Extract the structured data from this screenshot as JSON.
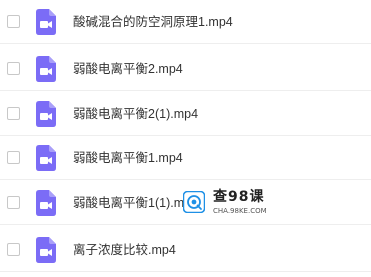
{
  "files": [
    {
      "name": "酸碱混合的防空洞原理1.mp4",
      "icon": "video-file-icon"
    },
    {
      "name": "弱酸电离平衡2.mp4",
      "icon": "video-file-icon"
    },
    {
      "name": "弱酸电离平衡2(1).mp4",
      "icon": "video-file-icon"
    },
    {
      "name": "弱酸电离平衡1.mp4",
      "icon": "video-file-icon"
    },
    {
      "name": "弱酸电离平衡1(1).mp4",
      "icon": "video-file-icon"
    },
    {
      "name": "离子浓度比较.mp4",
      "icon": "video-file-icon"
    }
  ],
  "watermark": {
    "title": "查98课",
    "subtitle": "CHA.98KE.COM"
  },
  "colors": {
    "icon_purple": "#7b6cf6",
    "text": "#333333",
    "divider": "#eeeeee",
    "checkbox_border": "#c8c8c8"
  }
}
